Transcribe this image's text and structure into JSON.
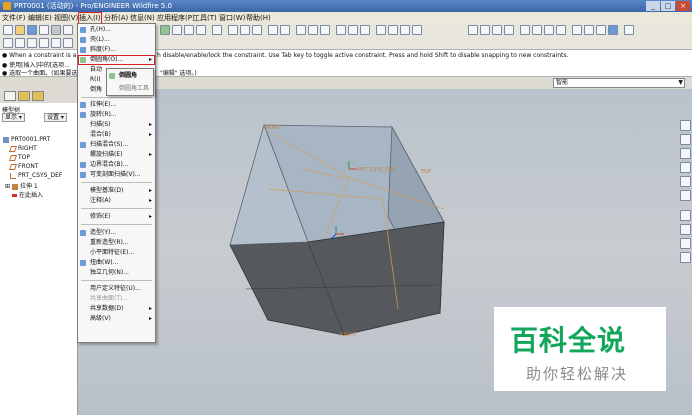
{
  "window": {
    "title": "PRT0001 (活动的) - Pro/ENGINEER Wildfire 5.0"
  },
  "menubar": {
    "items": [
      "文件(F)",
      "编辑(E)",
      "视图(V)",
      "插入(I)",
      "分析(A)",
      "信息(N)",
      "应用程序(P)",
      "工具(T)",
      "窗口(W)",
      "帮助(H)"
    ]
  },
  "messages": {
    "line1": "● When a constraint is a",
    "line1_tail": "h disable/enable/lock the constraint. Use Tab key to toggle active constraint. Press and hold Shift to disable snapping to new constraints.",
    "line2": "● 使用[插入]中的[选项...",
    "line3": "● 选取一个曲面。(如果要选...",
    "line3_tail": "\"编辑\" 选项。)"
  },
  "filter": {
    "value": "智能"
  },
  "model_tree": {
    "title": "模型树",
    "show_button": "显示 ▾",
    "settings_button": "设置 ▾",
    "nodes": [
      "PRT0001.PRT",
      "RIGHT",
      "TOP",
      "FRONT",
      "PRT_CSYS_DEF",
      "拉伸 1",
      "在此插入"
    ]
  },
  "insert_menu": {
    "items": [
      {
        "label": "孔(H)...",
        "submenu": false,
        "disabled": false
      },
      {
        "label": "壳(L)...",
        "submenu": false,
        "disabled": false
      },
      {
        "label": "斜度(F)...",
        "submenu": false,
        "disabled": false
      },
      {
        "label": "倒圆角(O)...",
        "submenu": false,
        "disabled": false,
        "highlighted": true
      },
      {
        "label": "自动",
        "submenu": false,
        "disabled": false
      },
      {
        "label": "R(I)",
        "submenu": false,
        "disabled": false
      },
      {
        "label": "倒角",
        "submenu": false,
        "disabled": false
      },
      {
        "label": "拉伸(E)...",
        "submenu": false,
        "disabled": false
      },
      {
        "label": "旋转(R)...",
        "submenu": false,
        "disabled": false
      },
      {
        "label": "扫描(S)",
        "submenu": true,
        "disabled": false
      },
      {
        "label": "混合(B)",
        "submenu": true,
        "disabled": false
      },
      {
        "label": "扫描混合(S)...",
        "submenu": false,
        "disabled": false
      },
      {
        "label": "螺旋扫描(E)",
        "submenu": true,
        "disabled": false
      },
      {
        "label": "边界混合(B)...",
        "submenu": false,
        "disabled": false
      },
      {
        "label": "可变剖面扫描(V)...",
        "submenu": false,
        "disabled": false
      },
      {
        "label": "模型基准(D)",
        "submenu": true,
        "disabled": false
      },
      {
        "label": "注释(A)",
        "submenu": true,
        "disabled": false
      },
      {
        "label": "修饰(E)",
        "submenu": true,
        "disabled": false
      },
      {
        "label": "造型(Y)...",
        "submenu": false,
        "disabled": false
      },
      {
        "label": "重新造型(R)...",
        "submenu": false,
        "disabled": false
      },
      {
        "label": "小平面特征(E)...",
        "submenu": false,
        "disabled": false
      },
      {
        "label": "扭曲(W)...",
        "submenu": false,
        "disabled": false
      },
      {
        "label": "独立几何(N)...",
        "submenu": false,
        "disabled": false
      },
      {
        "label": "用户定义特征(U)...",
        "submenu": false,
        "disabled": false
      },
      {
        "label": "共享曲面(T)...",
        "submenu": false,
        "disabled": true
      },
      {
        "label": "共享数据(D)",
        "submenu": true,
        "disabled": false
      },
      {
        "label": "高级(V)",
        "submenu": true,
        "disabled": false
      }
    ]
  },
  "round_submenu": {
    "items": [
      "倒圆角",
      "倒圆角工具"
    ]
  },
  "viewport": {
    "labels": {
      "top_plane": "FRONT",
      "mid_label": "PRT_CSYS_DEF",
      "top_label": "TOP",
      "bottom_label": "RIGHT"
    }
  },
  "watermark": {
    "main": "百科全说",
    "sub": "助你轻松解决"
  },
  "colors": {
    "title_bar": "#3a66a8",
    "menu_highlight": "#e02020",
    "watermark_green": "#12a65a"
  }
}
